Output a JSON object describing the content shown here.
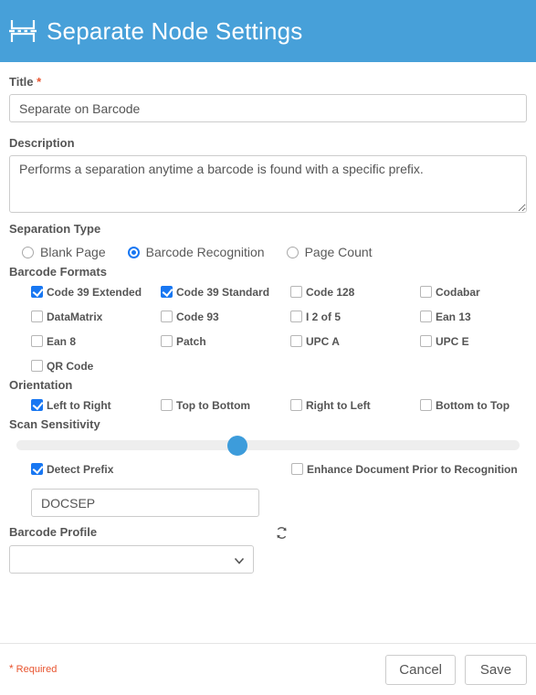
{
  "header": {
    "title": "Separate Node Settings",
    "icon": "separate-node-icon",
    "background_color": "#47a0d9"
  },
  "colors": {
    "header_blue": "#47a0d9",
    "accent_blue": "#1877f2",
    "slider_blue": "#3d9cdb",
    "required_orange": "#e8542f",
    "label_gray": "#555555"
  },
  "form": {
    "title_field": {
      "label": "Title",
      "required_marker": "*",
      "value": "Separate on Barcode",
      "placeholder": ""
    },
    "description_field": {
      "label": "Description",
      "value": "Performs a separation anytime a barcode is found with a specific prefix.",
      "placeholder": ""
    },
    "separation_type": {
      "label": "Separation Type",
      "selected": "Barcode Recognition",
      "options": [
        {
          "label": "Blank Page",
          "checked": false
        },
        {
          "label": "Barcode Recognition",
          "checked": true
        },
        {
          "label": "Page Count",
          "checked": false
        }
      ]
    },
    "barcode_formats": {
      "label": "Barcode Formats",
      "options": [
        {
          "label": "Code 39 Extended",
          "checked": true
        },
        {
          "label": "Code 39 Standard",
          "checked": true
        },
        {
          "label": "Code 128",
          "checked": false
        },
        {
          "label": "Codabar",
          "checked": false
        },
        {
          "label": "DataMatrix",
          "checked": false
        },
        {
          "label": "Code 93",
          "checked": false
        },
        {
          "label": "I 2 of 5",
          "checked": false
        },
        {
          "label": "Ean 13",
          "checked": false
        },
        {
          "label": "Ean 8",
          "checked": false
        },
        {
          "label": "Patch",
          "checked": false
        },
        {
          "label": "UPC A",
          "checked": false
        },
        {
          "label": "UPC E",
          "checked": false
        },
        {
          "label": "QR Code",
          "checked": false
        }
      ]
    },
    "orientation": {
      "label": "Orientation",
      "options": [
        {
          "label": "Left to Right",
          "checked": true
        },
        {
          "label": "Top to Bottom",
          "checked": false
        },
        {
          "label": "Right to Left",
          "checked": false
        },
        {
          "label": "Bottom to Top",
          "checked": false
        }
      ]
    },
    "scan_sensitivity": {
      "label": "Scan Sensitivity",
      "value_percent": 44
    },
    "detect_prefix": {
      "label": "Detect Prefix",
      "checked": true,
      "value": "DOCSEP",
      "placeholder": ""
    },
    "enhance_document": {
      "label": "Enhance Document Prior to Recognition",
      "checked": false
    },
    "barcode_profile": {
      "label": "Barcode Profile",
      "refresh_icon": "refresh-icon",
      "selected_value": "",
      "options": []
    }
  },
  "footer": {
    "required_star": "*",
    "required_text": "Required",
    "cancel_label": "Cancel",
    "save_label": "Save"
  }
}
